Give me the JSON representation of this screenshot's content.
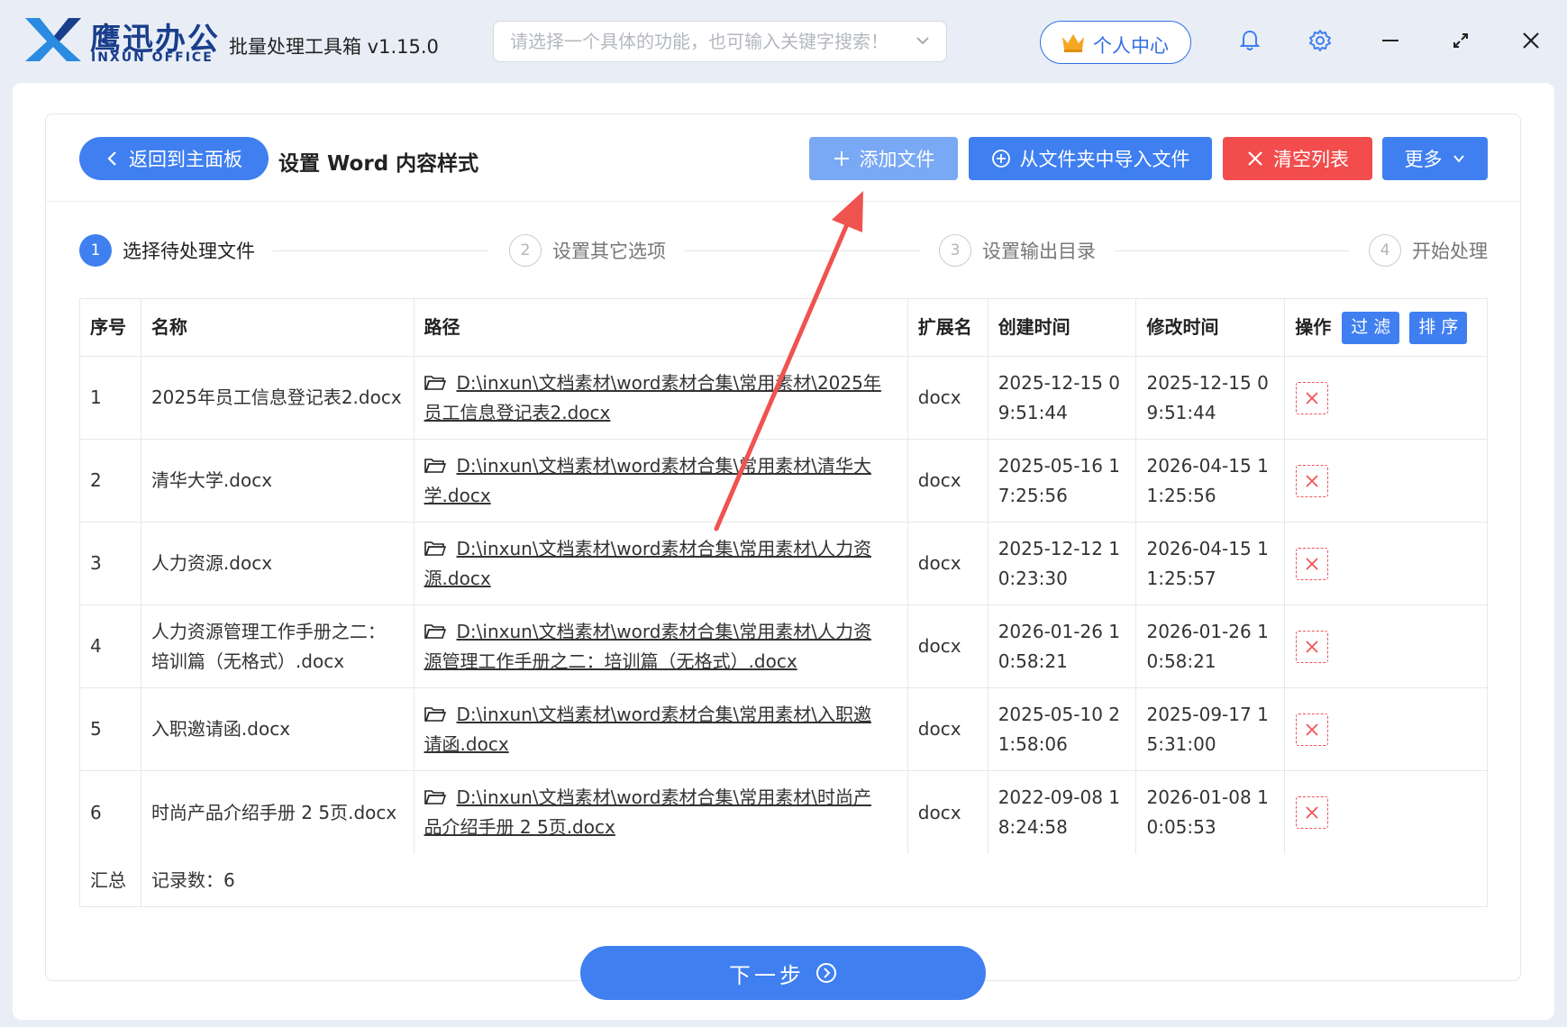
{
  "app": {
    "brand_cn": "鹰迅办公",
    "brand_en": "INXUN OFFICE",
    "title": "批量处理工具箱 v1.15.0",
    "search_placeholder": "请选择一个具体的功能，也可输入关键字搜索！",
    "user_center": "个人中心"
  },
  "toolbar": {
    "back": "返回到主面板",
    "page_title": "设置 Word 内容样式",
    "add_file": "添加文件",
    "import_folder": "从文件夹中导入文件",
    "clear_list": "清空列表",
    "more": "更多"
  },
  "steps": [
    {
      "num": "1",
      "label": "选择待处理文件",
      "active": true
    },
    {
      "num": "2",
      "label": "设置其它选项",
      "active": false
    },
    {
      "num": "3",
      "label": "设置输出目录",
      "active": false
    },
    {
      "num": "4",
      "label": "开始处理",
      "active": false
    }
  ],
  "table": {
    "headers": [
      "序号",
      "名称",
      "路径",
      "扩展名",
      "创建时间",
      "修改时间",
      "操作"
    ],
    "filter_label": "过 滤",
    "sort_label": "排 序",
    "rows": [
      {
        "idx": "1",
        "name": [
          "2025年员工信息登记表2.docx"
        ],
        "path": [
          "D:\\inxun\\文档素材\\word素材合集\\常用素材\\2025年",
          "员工信息登记表2.docx"
        ],
        "ext": "docx",
        "created": [
          "2025-12-15 0",
          "9:51:44"
        ],
        "modified": [
          "2025-12-15 0",
          "9:51:44"
        ]
      },
      {
        "idx": "2",
        "name": [
          "清华大学.docx"
        ],
        "path": [
          "D:\\inxun\\文档素材\\word素材合集\\常用素材\\清华大",
          "学.docx"
        ],
        "ext": "docx",
        "created": [
          "2025-05-16 1",
          "7:25:56"
        ],
        "modified": [
          "2026-04-15 1",
          "1:25:56"
        ]
      },
      {
        "idx": "3",
        "name": [
          "人力资源.docx"
        ],
        "path": [
          "D:\\inxun\\文档素材\\word素材合集\\常用素材\\人力资",
          "源.docx"
        ],
        "ext": "docx",
        "created": [
          "2025-12-12 1",
          "0:23:30"
        ],
        "modified": [
          "2026-04-15 1",
          "1:25:57"
        ]
      },
      {
        "idx": "4",
        "name": [
          "人力资源管理工作手册之二：",
          "培训篇（无格式）.docx"
        ],
        "path": [
          "D:\\inxun\\文档素材\\word素材合集\\常用素材\\人力资",
          "源管理工作手册之二：培训篇（无格式）.docx"
        ],
        "ext": "docx",
        "created": [
          "2026-01-26 1",
          "0:58:21"
        ],
        "modified": [
          "2026-01-26 1",
          "0:58:21"
        ]
      },
      {
        "idx": "5",
        "name": [
          "入职邀请函.docx"
        ],
        "path": [
          "D:\\inxun\\文档素材\\word素材合集\\常用素材\\入职邀",
          "请函.docx"
        ],
        "ext": "docx",
        "created": [
          "2025-05-10 2",
          "1:58:06"
        ],
        "modified": [
          "2025-09-17 1",
          "5:31:00"
        ]
      },
      {
        "idx": "6",
        "name": [
          "时尚产品介绍手册 2 5页.docx"
        ],
        "path": [
          "D:\\inxun\\文档素材\\word素材合集\\常用素材\\时尚产",
          "品介绍手册 2 5页.docx"
        ],
        "ext": "docx",
        "created": [
          "2022-09-08 1",
          "8:24:58"
        ],
        "modified": [
          "2026-01-08 1",
          "0:05:53"
        ]
      }
    ],
    "summary_label": "汇总",
    "summary_count": "记录数：6"
  },
  "next_button": "下一步",
  "colors": {
    "accent": "#3f7ff0",
    "danger": "#f24c4c",
    "annotation_arrow": "#ef5350"
  }
}
